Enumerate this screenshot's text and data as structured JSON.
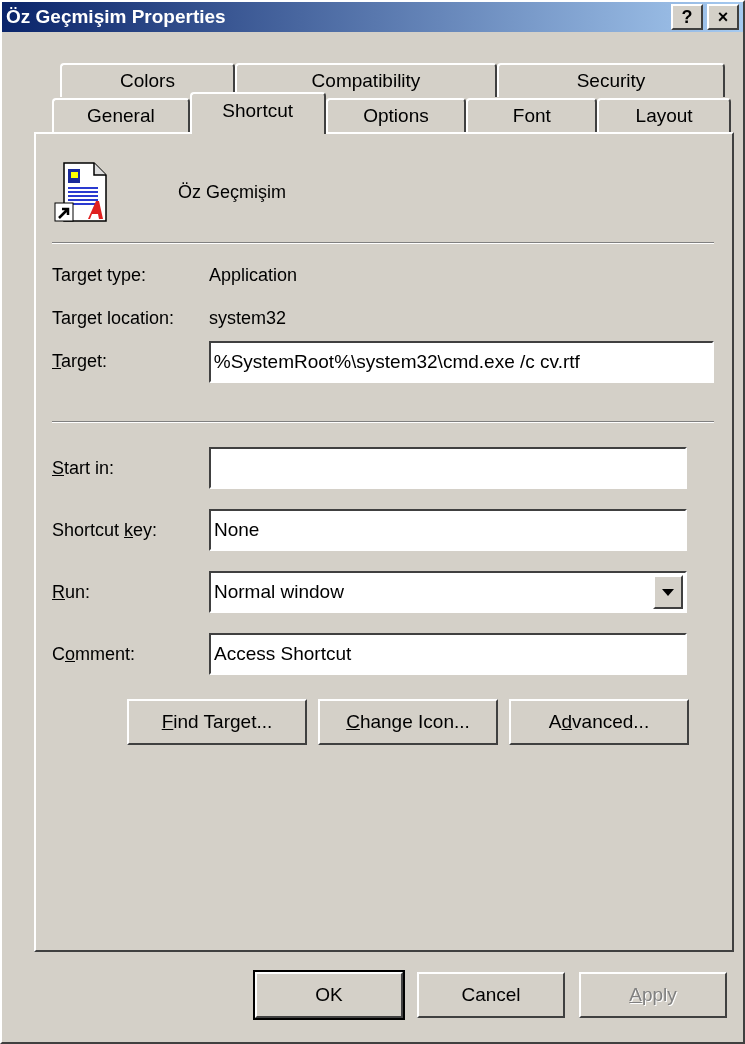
{
  "window": {
    "title": "Öz Geçmişim Properties",
    "help_button": "?",
    "close_button": "×"
  },
  "tab_rows": [
    [
      {
        "label": "Colors",
        "selected": false
      },
      {
        "label": "Compatibility",
        "selected": false
      },
      {
        "label": "Security",
        "selected": false
      }
    ],
    [
      {
        "label": "General",
        "selected": false
      },
      {
        "label": "Shortcut",
        "selected": true
      },
      {
        "label": "Options",
        "selected": false
      },
      {
        "label": "Font",
        "selected": false
      },
      {
        "label": "Layout",
        "selected": false
      }
    ]
  ],
  "shortcut_name": "Öz Geçmişim",
  "info": [
    {
      "label": "Target type:",
      "value": "Application"
    },
    {
      "label": "Target location:",
      "value": "system32"
    }
  ],
  "target": {
    "label": {
      "key": "T",
      "post": "arget:"
    },
    "value": "%SystemRoot%\\system32\\cmd.exe /c cv.rtf"
  },
  "fields": [
    {
      "kind": "text",
      "label": {
        "key": "S",
        "post": "tart in:"
      }
    },
    {
      "kind": "text",
      "label": {
        "pre": "Shortcut ",
        "key": "k",
        "post": "ey:"
      },
      "value": "None"
    },
    {
      "kind": "dropdown",
      "label": {
        "key": "R",
        "post": "un:"
      },
      "value": "Normal window"
    },
    {
      "kind": "text",
      "label": {
        "pre": "C",
        "key": "o",
        "post": "mment:"
      },
      "value": "Access Shortcut"
    }
  ],
  "actions": [
    {
      "label": {
        "key": "F",
        "post": "ind Target..."
      }
    },
    {
      "label": {
        "key": "C",
        "post": "hange Icon..."
      }
    },
    {
      "label": {
        "pre": "A",
        "key": "d",
        "post": "vanced..."
      }
    }
  ],
  "buttons": [
    {
      "label": {
        "post": "OK"
      },
      "default": true,
      "disabled": false
    },
    {
      "label": {
        "post": "Cancel"
      },
      "default": false,
      "disabled": false
    },
    {
      "label": {
        "key": "A",
        "post": "pply"
      },
      "default": false,
      "disabled": true
    }
  ]
}
